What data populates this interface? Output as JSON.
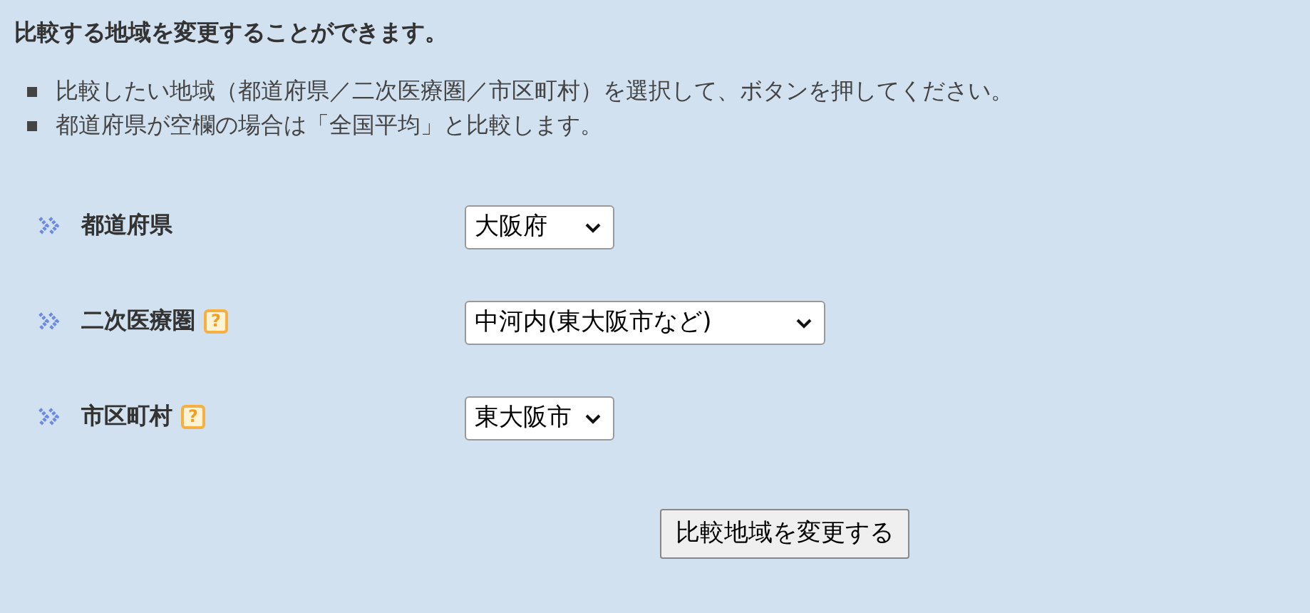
{
  "heading": "比較する地域を変更することができます。",
  "notes": [
    "比較したい地域（都道府県／二次医療圏／市区町村）を選択して、ボタンを押してください。",
    "都道府県が空欄の場合は「全国平均」と比較します。"
  ],
  "fields": [
    {
      "label": "都道府県",
      "value": "大阪府"
    },
    {
      "label": "二次医療圏",
      "help": "?",
      "value": "中河内(東大阪市など)"
    },
    {
      "label": "市区町村",
      "help": "?",
      "value": "東大阪市"
    }
  ],
  "button": "比較地域を変更する"
}
